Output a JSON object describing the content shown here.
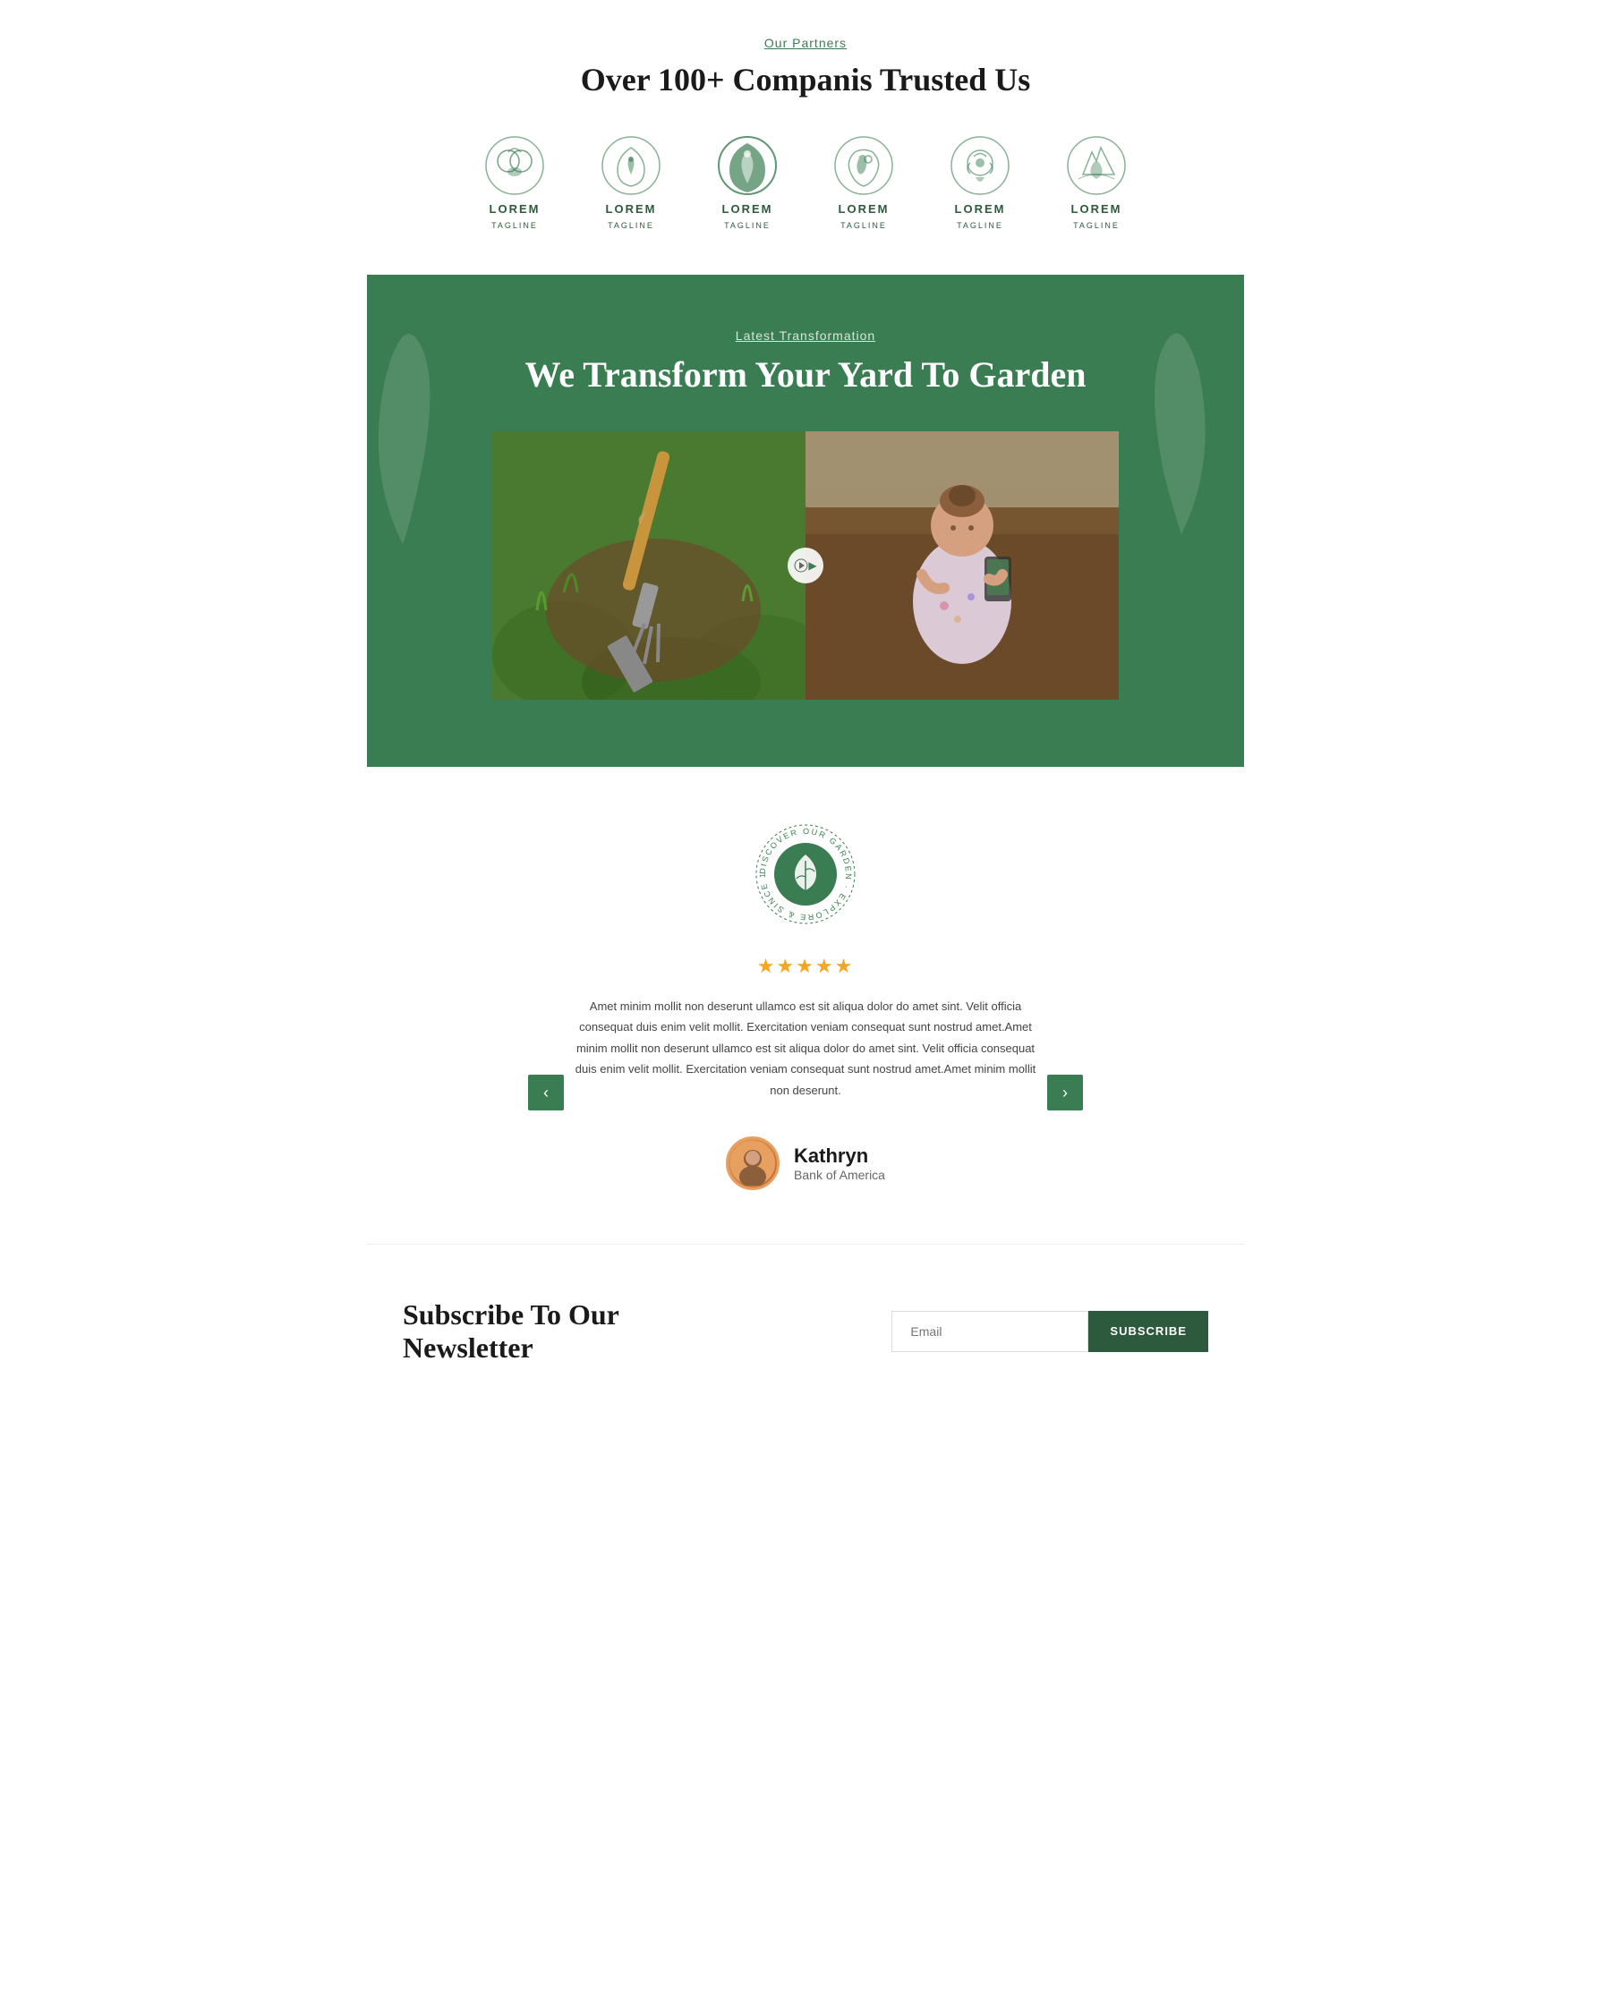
{
  "partners": {
    "label": "Our Partners",
    "title": "Over 100+ Companis Trusted Us",
    "logos": [
      {
        "name": "LOREM",
        "tagline": "TAGLINE"
      },
      {
        "name": "LOREM",
        "tagline": "TAGLINE"
      },
      {
        "name": "LOREM",
        "tagline": "TAGLINE"
      },
      {
        "name": "LOREM",
        "tagline": "TAGLINE"
      },
      {
        "name": "LOREM",
        "tagline": "TAGLINE"
      },
      {
        "name": "LOREM",
        "tagline": "TAGLINE"
      }
    ]
  },
  "transformation": {
    "label": "Latest Transformation",
    "title": "We Transform Your Yard To Garden"
  },
  "testimonial": {
    "stars": "★★★★★",
    "text": "Amet minim mollit non deserunt ullamco est sit aliqua dolor do amet sint. Velit officia consequat duis enim velit mollit. Exercitation veniam consequat sunt nostrud amet.Amet minim mollit non deserunt ullamco est sit aliqua dolor do amet sint. Velit officia consequat duis enim velit mollit. Exercitation veniam consequat sunt nostrud amet.Amet minim mollit non deserunt.",
    "reviewer_name": "Kathryn",
    "reviewer_company": "Bank of America",
    "badge_text": "DISCOVER OUR GARDEN · EXPLORE & SINCE 1997 ·",
    "prev_label": "‹",
    "next_label": "›"
  },
  "newsletter": {
    "title": "Subscribe To Our Newsletter",
    "email_placeholder": "Email",
    "button_label": "SUBSCRIBE"
  }
}
